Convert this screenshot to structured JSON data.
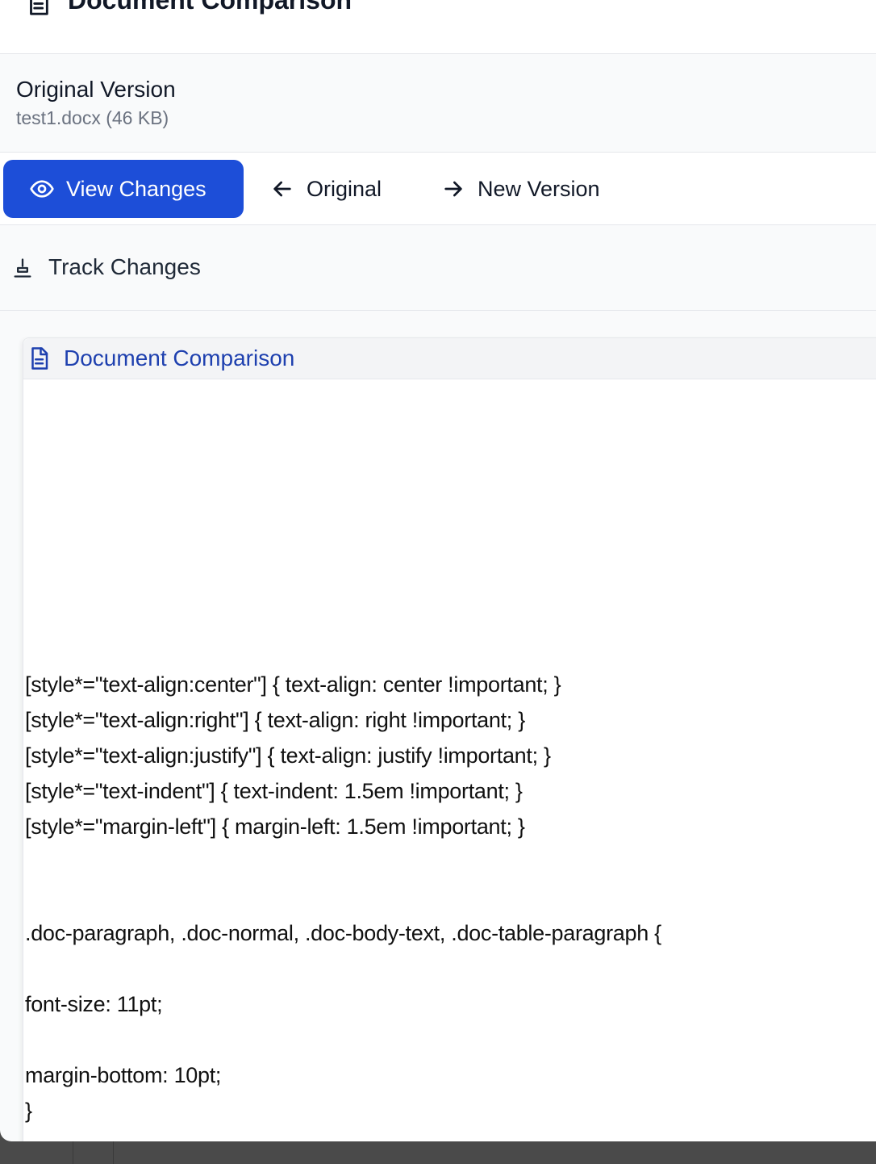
{
  "header": {
    "title": "Document Comparison",
    "icon": "document-icon"
  },
  "file_info": {
    "title": "Original Version",
    "file": "test1.docx (46 KB)"
  },
  "tabs": [
    {
      "label": "View Changes",
      "icon": "eye-icon",
      "active": true
    },
    {
      "label": "Original",
      "icon": "arrow-left-icon",
      "active": false
    },
    {
      "label": "New Version",
      "icon": "arrow-right-icon",
      "active": false
    }
  ],
  "track_changes": {
    "label": "Track Changes",
    "icon": "stamp-icon"
  },
  "document": {
    "title": "Document Comparison",
    "icon": "document-icon",
    "lines": [
      "[style*=\"text-align:center\"] { text-align: center !important; }",
      "[style*=\"text-align:right\"] { text-align: right !important; }",
      "[style*=\"text-align:justify\"] { text-align: justify !important; }",
      "[style*=\"text-indent\"] { text-indent: 1.5em !important; }",
      "[style*=\"margin-left\"] { margin-left: 1.5em !important; }",
      ".doc-paragraph, .doc-normal, .doc-body-text, .doc-table-paragraph {",
      "font-size: 11pt;",
      "margin-bottom: 10pt;",
      "}"
    ]
  },
  "colors": {
    "accent": "#1d4ed8",
    "link_title": "#1e40af",
    "border": "#e5e7eb"
  }
}
